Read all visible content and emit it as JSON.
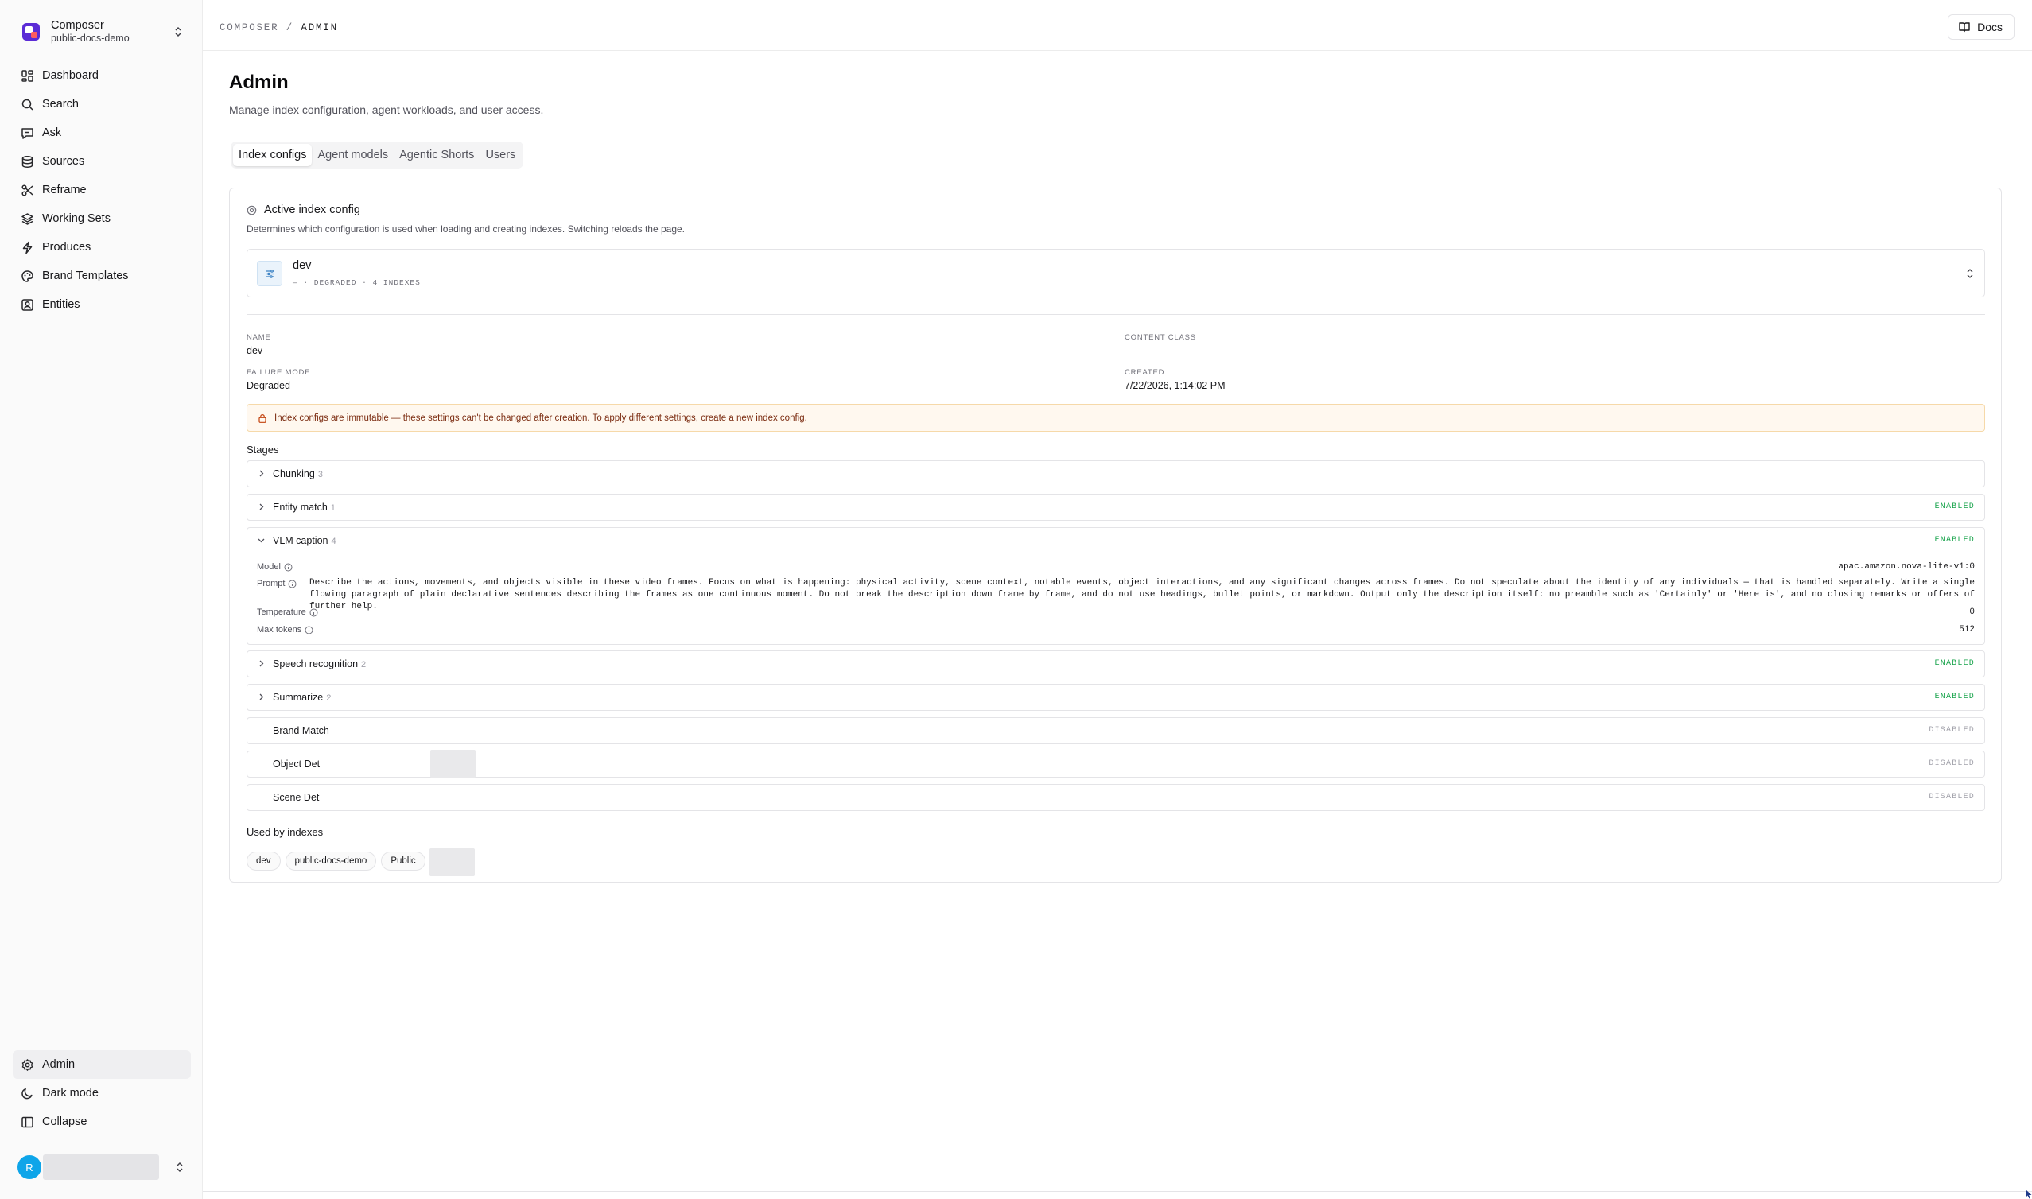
{
  "org": {
    "name": "Composer",
    "workspace": "public-docs-demo"
  },
  "nav": {
    "primary": [
      {
        "label": "Dashboard",
        "icon": "dashboard-icon"
      },
      {
        "label": "Search",
        "icon": "search-icon"
      },
      {
        "label": "Ask",
        "icon": "chat-icon"
      },
      {
        "label": "Sources",
        "icon": "database-icon"
      },
      {
        "label": "Reframe",
        "icon": "scissors-icon"
      },
      {
        "label": "Working Sets",
        "icon": "layers-icon"
      },
      {
        "label": "Produces",
        "icon": "bolt-icon"
      },
      {
        "label": "Brand Templates",
        "icon": "palette-icon"
      },
      {
        "label": "Entities",
        "icon": "contact-icon"
      }
    ],
    "bottom": [
      {
        "label": "Admin",
        "icon": "gear-icon",
        "active": true
      },
      {
        "label": "Dark mode",
        "icon": "moon-icon"
      },
      {
        "label": "Collapse",
        "icon": "panel-icon"
      }
    ]
  },
  "user": {
    "initial": "R"
  },
  "header": {
    "crumb_parent": "COMPOSER",
    "crumb_sep": "/",
    "crumb_current": "ADMIN",
    "docs_label": "Docs"
  },
  "page": {
    "title": "Admin",
    "subtitle": "Manage index configuration, agent workloads, and user access."
  },
  "tabs": [
    {
      "label": "Index configs",
      "active": true
    },
    {
      "label": "Agent models"
    },
    {
      "label": "Agentic Shorts"
    },
    {
      "label": "Users"
    }
  ],
  "active_config": {
    "heading": "Active index config",
    "description": "Determines which configuration is used when loading and creating indexes. Switching reloads the page.",
    "selected": {
      "name": "dev",
      "meta": "— · DEGRADED · 4 INDEXES"
    },
    "fields": {
      "name_label": "NAME",
      "name_value": "dev",
      "content_class_label": "CONTENT CLASS",
      "content_class_value": "—",
      "failure_mode_label": "FAILURE MODE",
      "failure_mode_value": "Degraded",
      "created_label": "CREATED",
      "created_value": "7/22/2026, 1:14:02 PM"
    },
    "warning": "Index configs are immutable — these settings can't be changed after creation. To apply different settings, create a new index config.",
    "stages_label": "Stages",
    "stages": [
      {
        "name": "Chunking",
        "count": "3",
        "status": ""
      },
      {
        "name": "Entity match",
        "count": "1",
        "status": "ENABLED"
      },
      {
        "name": "VLM caption",
        "count": "4",
        "status": "ENABLED",
        "expanded": true
      },
      {
        "name": "Speech recognition",
        "count": "2",
        "status": "ENABLED"
      },
      {
        "name": "Summarize",
        "count": "2",
        "status": "ENABLED"
      },
      {
        "name": "Brand Match",
        "count": "",
        "status": "DISABLED"
      },
      {
        "name": "Object Det",
        "count": "",
        "status": "DISABLED"
      },
      {
        "name": "Scene Det",
        "count": "",
        "status": "DISABLED"
      }
    ],
    "vlm": {
      "model_label": "Model",
      "model_value": "apac.amazon.nova-lite-v1:0",
      "prompt_label": "Prompt",
      "prompt_value": "Describe the actions, movements, and objects visible in these video frames. Focus on what is happening: physical activity, scene context, notable events, object interactions, and any significant changes across frames. Do not speculate about the identity of any individuals — that is handled separately. Write a single flowing paragraph of plain declarative sentences describing the frames as one continuous moment. Do not break the description down frame by frame, and do not use headings, bullet points, or markdown. Output only the description itself: no preamble such as 'Certainly' or 'Here is', and no closing remarks or offers of further help.",
      "temperature_label": "Temperature",
      "temperature_value": "0",
      "max_tokens_label": "Max tokens",
      "max_tokens_value": "512"
    },
    "used_by_label": "Used by indexes",
    "used_by": [
      "dev",
      "public-docs-demo",
      "Public"
    ]
  },
  "colors": {
    "enabled": "#16a34a",
    "disabled": "#a1a1aa",
    "warning_bg": "#fff8ef",
    "accent_avatar": "#0ea5e9"
  }
}
